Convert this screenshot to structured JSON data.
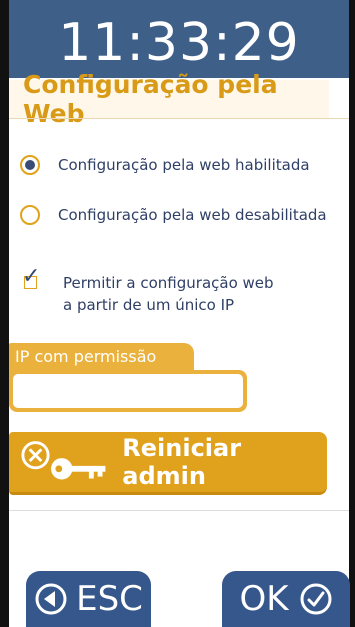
{
  "clock": {
    "time": "11:33:29"
  },
  "title": "Configuração pela Web",
  "options": [
    {
      "label": "Configuração pela web habilitada",
      "selected": true
    },
    {
      "label": "Configuração pela web desabilitada",
      "selected": false
    }
  ],
  "single_ip": {
    "checked": true,
    "line1": "Permitir a configuração web",
    "line2": "a partir de um único IP"
  },
  "ip_field": {
    "label": "IP com permissão",
    "value": ""
  },
  "reset_button": {
    "label": "Reiniciar admin",
    "icon": "key-reset-icon"
  },
  "footer": {
    "esc_label": "ESC",
    "ok_label": "OK"
  },
  "colors": {
    "header_blue": "#3e5f88",
    "accent_gold": "#e0a21d",
    "text_blue": "#2f3f66"
  }
}
